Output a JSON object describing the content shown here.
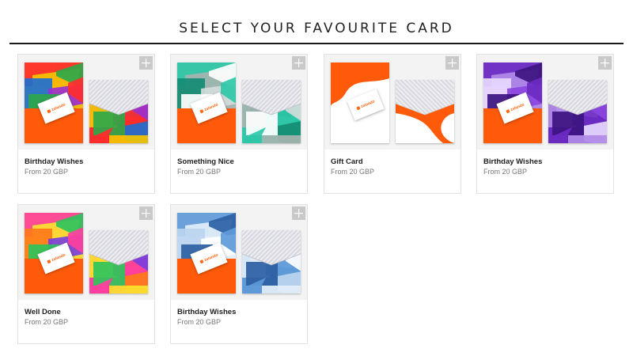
{
  "page": {
    "title": "SELECT YOUR FAVOURITE CARD"
  },
  "cards": [
    {
      "name": "Birthday Wishes",
      "price": "From 20 GBP",
      "pattern": "multicolor",
      "colors": [
        "#ff2d2d",
        "#f5c400",
        "#2ea84a",
        "#1e6fd0",
        "#9b2fd1"
      ]
    },
    {
      "name": "Something Nice",
      "price": "From 20 GBP",
      "pattern": "teal",
      "colors": [
        "#2fc8a8",
        "#a5b3b0",
        "#ffffff",
        "#148c73",
        "#d3dcda"
      ]
    },
    {
      "name": "Gift Card",
      "price": "From 20 GBP",
      "pattern": "orange-white",
      "colors": [
        "#ff5a0a",
        "#ffffff"
      ]
    },
    {
      "name": "Birthday Wishes",
      "price": "From 20 GBP",
      "pattern": "purple",
      "colors": [
        "#6b2bc2",
        "#b18be8",
        "#3d1480",
        "#e7d9ff",
        "#8c45e0"
      ]
    },
    {
      "name": "Well Done",
      "price": "From 20 GBP",
      "pattern": "confetti",
      "colors": [
        "#ff3f9e",
        "#ffe22d",
        "#2ec45b",
        "#ff7a1a",
        "#7a3fe0"
      ]
    },
    {
      "name": "Birthday Wishes",
      "price": "From 20 GBP",
      "pattern": "silver-blue",
      "colors": [
        "#5f9ad8",
        "#e3eef9",
        "#2c5fa3",
        "#bcd5ef",
        "#ffffff"
      ]
    }
  ],
  "card_logo": "zalando",
  "accent": "#ff5a0a",
  "icons": {
    "add": "plus-icon"
  }
}
